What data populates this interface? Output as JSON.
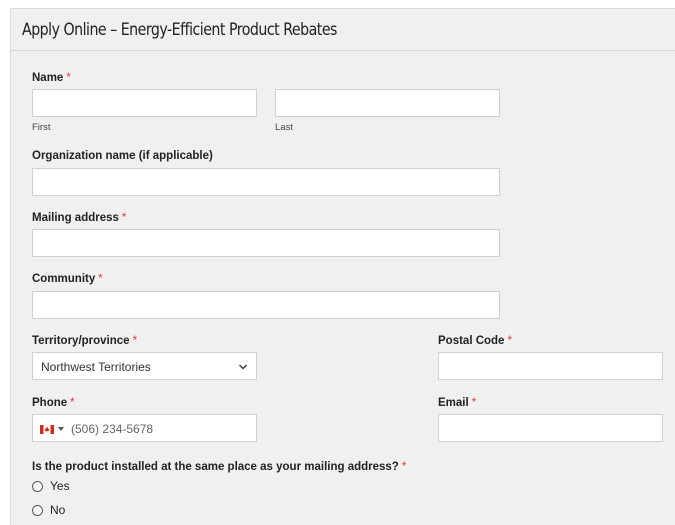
{
  "form": {
    "title": "Apply Online – Energy-Efficient Product Rebates",
    "name_label": "Name",
    "first_sublabel": "First",
    "last_sublabel": "Last",
    "organization_label": "Organization name (if applicable)",
    "mailing_label": "Mailing address",
    "community_label": "Community",
    "province_label": "Territory/province",
    "province_value": "Northwest Territories",
    "postal_label": "Postal Code",
    "phone_label": "Phone",
    "phone_placeholder": "(506) 234-5678",
    "phone_country_icon": "canada-flag-icon",
    "email_label": "Email",
    "same_place_question": "Is the product installed at the same place as your mailing address?",
    "options": [
      "Yes",
      "No"
    ],
    "required_mark": "*"
  },
  "colors": {
    "panel_bg": "#f0f0f0",
    "required": "#e0383e",
    "input_border": "#d0d0d0"
  }
}
